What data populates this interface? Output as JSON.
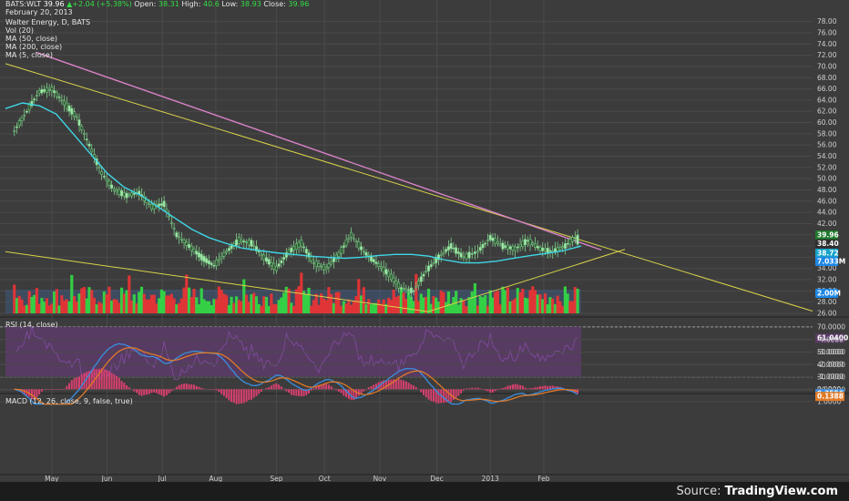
{
  "header": {
    "ticker": "BATS:WLT",
    "last": "39.96",
    "change": "▲+2.04 (+5.38%)",
    "open_label": "Open:",
    "open": "38.31",
    "high_label": "High:",
    "high": "40.6",
    "low_label": "Low:",
    "low": "38.93",
    "close_label": "Close:",
    "close": "39.96",
    "date": "February 20, 2013"
  },
  "legend": {
    "title": "Walter Energy, D, BATS",
    "vol": "Vol (20)",
    "ma50": "MA (50, close)",
    "ma200": "MA (200, close)",
    "ma5": "MA (5, close)"
  },
  "rsi_label": "RSI (14, close)",
  "macd_label": "MACD (12, 26, close, 9, false, true)",
  "source": {
    "prefix": "Source:",
    "brand": "TradingView.com"
  },
  "colors": {
    "up": "#33dd44",
    "down": "#ee3333",
    "ma50": "#3fd6e6",
    "trendline_upper": "#d982c8",
    "trendline_yellow": "#d8d24a",
    "rsi_fill": "#5a3b66",
    "macd_line": "#3a8ee0",
    "signal_line": "#e07a28",
    "hist": "#d8406f",
    "price_badge": "#1f7a2c",
    "ma_badge": "#14a4c8",
    "vol_badge": "#1e88e5"
  },
  "chart_data": [
    {
      "type": "candlestick",
      "title": "Walter Energy, D, BATS",
      "x_ticks": [
        "May",
        "Jun",
        "Jul",
        "Aug",
        "Sep",
        "Oct",
        "Nov",
        "Dec",
        "2013",
        "Feb"
      ],
      "y_ticks": [
        "26.00",
        "28.00",
        "30.00",
        "32.00",
        "34.00",
        "36.00",
        "38.00",
        "40.00",
        "42.00",
        "44.00",
        "46.00",
        "48.00",
        "50.00",
        "52.00",
        "54.00",
        "56.00",
        "58.00",
        "60.00",
        "62.00",
        "64.00",
        "66.00",
        "68.00",
        "70.00",
        "72.00",
        "74.00",
        "76.00",
        "78.00"
      ],
      "ylim": [
        26,
        78
      ],
      "close_series": [
        {
          "date": "2012-04-10",
          "close": 58.5
        },
        {
          "date": "2012-04-17",
          "close": 62.0
        },
        {
          "date": "2012-04-24",
          "close": 65.5
        },
        {
          "date": "2012-05-01",
          "close": 66.0
        },
        {
          "date": "2012-05-08",
          "close": 63.5
        },
        {
          "date": "2012-05-15",
          "close": 61.0
        },
        {
          "date": "2012-05-22",
          "close": 56.0
        },
        {
          "date": "2012-05-29",
          "close": 51.0
        },
        {
          "date": "2012-06-05",
          "close": 48.0
        },
        {
          "date": "2012-06-12",
          "close": 47.0
        },
        {
          "date": "2012-06-19",
          "close": 47.5
        },
        {
          "date": "2012-06-26",
          "close": 45.0
        },
        {
          "date": "2012-07-03",
          "close": 45.5
        },
        {
          "date": "2012-07-10",
          "close": 40.0
        },
        {
          "date": "2012-07-17",
          "close": 38.0
        },
        {
          "date": "2012-07-24",
          "close": 36.0
        },
        {
          "date": "2012-07-31",
          "close": 34.5
        },
        {
          "date": "2012-08-07",
          "close": 37.0
        },
        {
          "date": "2012-08-14",
          "close": 39.0
        },
        {
          "date": "2012-08-21",
          "close": 38.5
        },
        {
          "date": "2012-08-28",
          "close": 36.0
        },
        {
          "date": "2012-09-04",
          "close": 34.0
        },
        {
          "date": "2012-09-11",
          "close": 37.0
        },
        {
          "date": "2012-09-18",
          "close": 38.5
        },
        {
          "date": "2012-09-25",
          "close": 35.0
        },
        {
          "date": "2012-10-02",
          "close": 34.0
        },
        {
          "date": "2012-10-09",
          "close": 36.5
        },
        {
          "date": "2012-10-16",
          "close": 40.0
        },
        {
          "date": "2012-10-23",
          "close": 37.0
        },
        {
          "date": "2012-10-30",
          "close": 35.0
        },
        {
          "date": "2012-11-06",
          "close": 33.0
        },
        {
          "date": "2012-11-13",
          "close": 30.5
        },
        {
          "date": "2012-11-20",
          "close": 30.0
        },
        {
          "date": "2012-11-27",
          "close": 33.5
        },
        {
          "date": "2012-12-04",
          "close": 36.0
        },
        {
          "date": "2012-12-11",
          "close": 38.0
        },
        {
          "date": "2012-12-18",
          "close": 36.0
        },
        {
          "date": "2012-12-26",
          "close": 37.0
        },
        {
          "date": "2013-01-02",
          "close": 39.5
        },
        {
          "date": "2013-01-09",
          "close": 38.0
        },
        {
          "date": "2013-01-16",
          "close": 37.5
        },
        {
          "date": "2013-01-23",
          "close": 39.0
        },
        {
          "date": "2013-01-30",
          "close": 37.5
        },
        {
          "date": "2013-02-06",
          "close": 37.0
        },
        {
          "date": "2013-02-13",
          "close": 38.0
        },
        {
          "date": "2013-02-20",
          "close": 39.96
        }
      ],
      "ma50_series": [
        62.5,
        63.5,
        63.0,
        61.5,
        58.0,
        54.5,
        51.0,
        48.5,
        47.0,
        45.0,
        43.0,
        41.0,
        39.5,
        38.5,
        37.6,
        37.2,
        36.8,
        36.5,
        36.2,
        36.0,
        35.8,
        36.0,
        36.3,
        36.5,
        36.5,
        36.2,
        35.5,
        35.0,
        35.0,
        35.3,
        35.8,
        36.3,
        36.7,
        37.2,
        38.0
      ],
      "price_labels": [
        "39.96",
        "38.40",
        "38.72"
      ],
      "volume_label": "7.033M",
      "volume_avg_label": "2.00M"
    },
    {
      "type": "line",
      "title": "RSI (14, close)",
      "y_ticks": [
        "20.0000",
        "30.0000",
        "40.0000",
        "50.0000",
        "60.0000",
        "70.0000"
      ],
      "ylim": [
        17,
        73
      ],
      "last_label": "61.0400",
      "last": 61.04
    },
    {
      "type": "line",
      "title": "MACD (12, 26, close, 9, false, true)",
      "y_ticks": [
        "-4.0000",
        "-3.0000",
        "-2.0000",
        "-1.0000",
        "0.0000",
        "1.0000"
      ],
      "ylim": [
        -4.2,
        1.3
      ],
      "macd_label": "0.3556",
      "signal_label": "0.1388",
      "macd_last": 0.3556,
      "signal_last": 0.1388
    }
  ]
}
